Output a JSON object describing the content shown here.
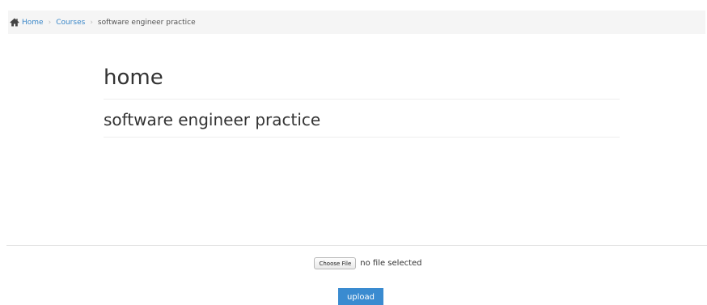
{
  "breadcrumb": {
    "items": [
      {
        "label": "Home",
        "icon": "home-icon",
        "link": true
      },
      {
        "label": "Courses",
        "link": true
      },
      {
        "label": "software engineer practice",
        "link": false
      }
    ],
    "separator": "›"
  },
  "main": {
    "title": "home",
    "subtitle": "software engineer practice"
  },
  "upload": {
    "choose_label": "Choose File",
    "status_text": "no file selected",
    "button_label": "upload"
  },
  "colors": {
    "link": "#3a87c8",
    "button": "#3a8bd0",
    "breadcrumb_bg": "#f5f5f5"
  }
}
